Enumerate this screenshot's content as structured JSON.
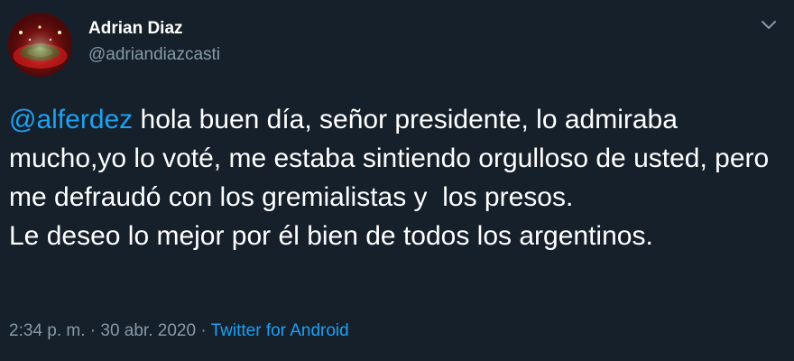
{
  "author": {
    "display_name": "Adrian Diaz",
    "handle": "@adriandiazcasti"
  },
  "tweet": {
    "mention": "@alferdez",
    "text": " hola buen día, señor presidente, lo admiraba mucho,yo lo voté, me estaba sintiendo orgulloso de usted, pero me defraudó con los gremialistas y  los presos.\nLe deseo lo mejor por él bien de todos los argentinos."
  },
  "meta": {
    "time": "2:34 p. m.",
    "separator": " · ",
    "date": "30 abr. 2020",
    "source": "Twitter for Android"
  },
  "icons": {
    "more": "chevron-down-icon",
    "avatar": "stadium-photo"
  },
  "colors": {
    "background": "#15202b",
    "link": "#1da1f2",
    "secondary_text": "#8899a6"
  }
}
